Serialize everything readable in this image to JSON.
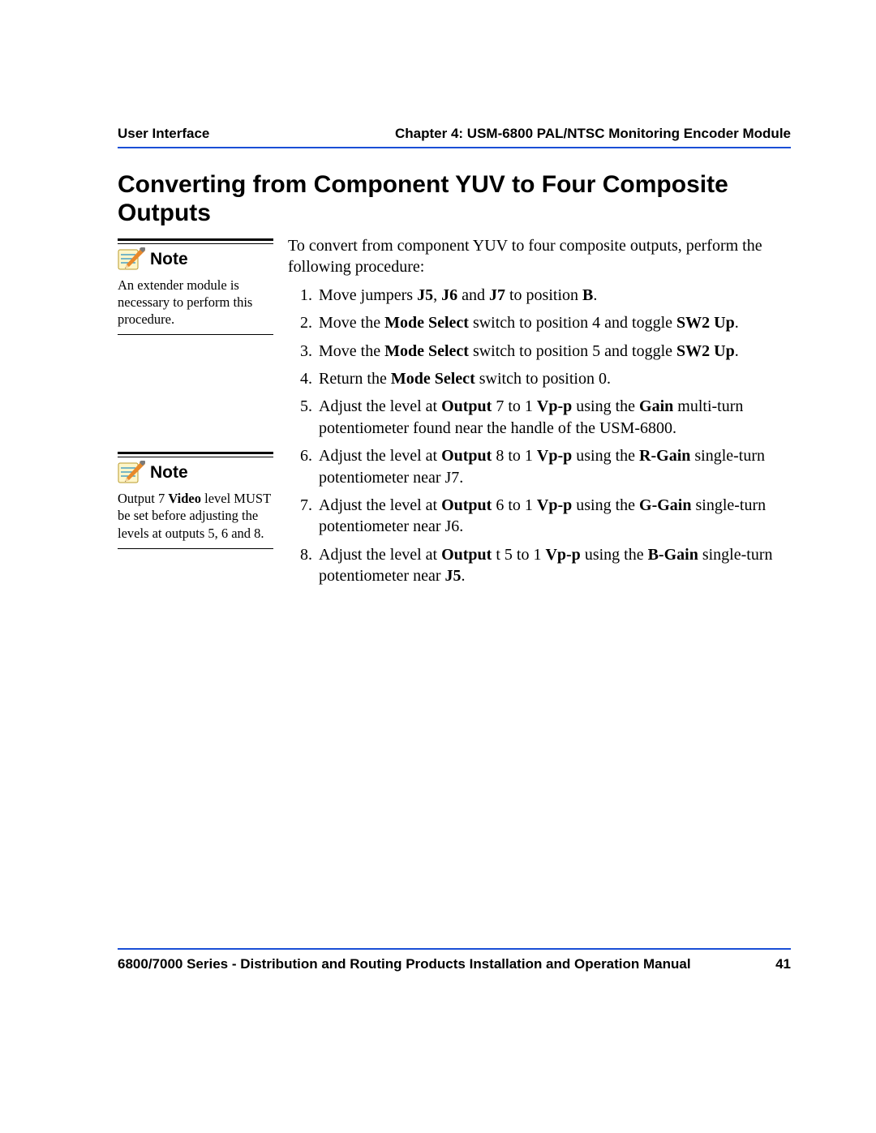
{
  "header": {
    "left": "User Interface",
    "right": "Chapter 4: USM-6800 PAL/NTSC Monitoring Encoder Module"
  },
  "title": "Converting from Component YUV to Four Composite Outputs",
  "notes": [
    {
      "label": "Note",
      "text_plain": "An extender module is necessary to perform this procedure."
    },
    {
      "label": "Note",
      "text_html": "Output 7 <span class=\"b\">Video</span> level MUST be set before adjusting the levels at outputs 5, 6 and 8."
    }
  ],
  "intro": "To convert from component YUV to four composite outputs, perform the following procedure:",
  "steps_html": [
    "Move jumpers <span class=\"b\">J5</span>, <span class=\"b\">J6</span> and <span class=\"b\">J7</span> to position <span class=\"b\">B</span>.",
    "Move the <span class=\"b\">Mode Select</span> switch to position 4 and toggle <span class=\"b\">SW2 Up</span>.",
    "Move the <span class=\"b\">Mode Select</span> switch to position 5 and toggle <span class=\"b\">SW2 Up</span>.",
    "Return the <span class=\"b\">Mode Select</span> switch to position 0.",
    "Adjust the level at <span class=\"b\">Output</span> 7 to 1 <span class=\"b\">Vp-p</span> using the <span class=\"b\">Gain</span> multi-turn potentiometer found near the handle of the USM-6800.",
    "Adjust the level at <span class=\"b\">Output</span> 8 to 1 <span class=\"b\">Vp-p</span> using the <span class=\"b\">R-Gain</span> single-turn potentiometer near J7.",
    "Adjust the level at <span class=\"b\">Output</span> 6 to 1 <span class=\"b\">Vp-p</span> using the <span class=\"b\">G-Gain</span> single-turn potentiometer near J6.",
    "Adjust the level at <span class=\"b\">Output</span> t 5 to 1 <span class=\"b\">Vp-p</span> using the <span class=\"b\">B-Gain</span> single-turn potentiometer near <span class=\"b\">J5</span>."
  ],
  "footer": {
    "left": "6800/7000 Series - Distribution and Routing Products Installation and Operation Manual",
    "page": "41"
  }
}
